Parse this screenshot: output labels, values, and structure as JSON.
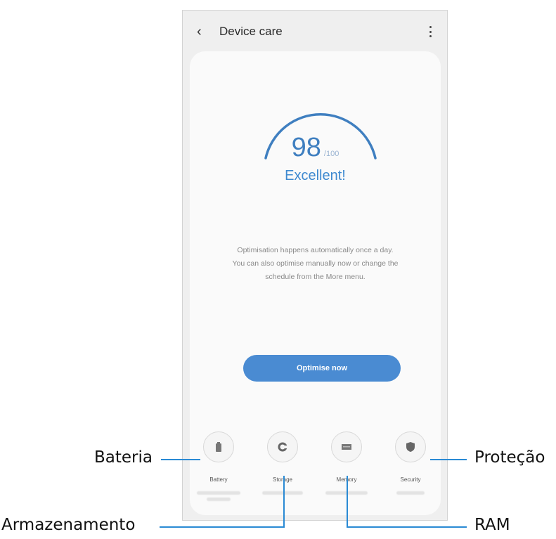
{
  "appbar": {
    "title": "Device care"
  },
  "score": {
    "value": "98",
    "max": "/100",
    "status": "Excellent!",
    "level": 0.98
  },
  "description": [
    "Optimisation happens automatically once a day.",
    "You can also optimise manually now or change the",
    "schedule from the More menu."
  ],
  "optimise_button": "Optimise now",
  "tools": [
    {
      "label": "Battery",
      "icon": "battery-icon"
    },
    {
      "label": "Storage",
      "icon": "storage-icon"
    },
    {
      "label": "Memory",
      "icon": "memory-icon"
    },
    {
      "label": "Security",
      "icon": "shield-icon"
    }
  ],
  "callouts": {
    "battery": "Bateria",
    "storage": "Armazenamento",
    "memory": "RAM",
    "security": "Proteção"
  },
  "colors": {
    "accent": "#4a8bd2",
    "callout_line": "#2a8ad4"
  }
}
